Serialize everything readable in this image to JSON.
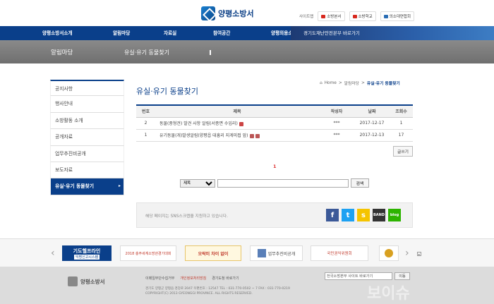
{
  "header": {
    "logo_text": "양평소방서",
    "sites_label": "사이트맵",
    "sites": [
      "소방본서",
      "소방학교",
      "의소대연합회"
    ]
  },
  "nav": {
    "items": [
      "양평소방서소개",
      "알림마당",
      "자료실",
      "참여공간",
      "양평의용소방대"
    ],
    "gg_link": "경기도재난안전본부 바로가기"
  },
  "band": {
    "section": "알림마당",
    "page": "유실·유기 동물찾기"
  },
  "sidebar": {
    "items": [
      {
        "label": "공지사항"
      },
      {
        "label": "행사안내"
      },
      {
        "label": "소방활동 소개"
      },
      {
        "label": "공개자료"
      },
      {
        "label": "업무추진비공개"
      },
      {
        "label": "보도자료"
      },
      {
        "label": "유실·유기 동물찾기",
        "arrow": "▸"
      }
    ]
  },
  "content": {
    "title": "유실·유기 동물찾기",
    "breadcrumb": {
      "home": "Home",
      "sep1": ">",
      "parent": "알림마당",
      "sep2": ">",
      "current": "유실·유기 동물찾기"
    },
    "table": {
      "headers": [
        "번호",
        "제목",
        "작성자",
        "날짜",
        "조회수"
      ],
      "rows": [
        {
          "no": "2",
          "title": "동물(중형견) 발견 사항 알림(서종면 수입리)",
          "author": "***",
          "date": "2017-12-17",
          "views": "1"
        },
        {
          "no": "1",
          "title": "유기동물(개)발생알림(양평읍 대흥리 지게미접 앞)",
          "author": "***",
          "date": "2017-12-13",
          "views": "17"
        }
      ]
    },
    "write_label": "글쓰기",
    "page_number": "1",
    "search": {
      "option": "제목",
      "button": "검색"
    },
    "sns_message": "해당 페이지는 SNS스크랩을 지원하고 있습니다.",
    "sns_icons": [
      "facebook-icon",
      "twitter-icon",
      "kakaostory-icon",
      "band-icon",
      "blog-icon"
    ]
  },
  "banners": {
    "b1": "기도헬프라인",
    "b1_sub": "익명신고시스템",
    "b2": "2018 충주세계소방관경기대회",
    "b3": "오락미 차이 없이",
    "b4": "업무추진비공개",
    "b5": "국민권익위원회"
  },
  "footer": {
    "logo_text": "양평소방서",
    "links": [
      "이메일무단수집거부",
      "개인정보처리방침",
      "경기도청 바로가기"
    ],
    "address1": "경기도 양평군 양평읍 경강로 2047 우편번호 : 12547  TEL : 031-770-0502 ~ 7  FAX : 031-770-0219",
    "address2": "COPYRIGHT(C) 2013 GYEONGGI PROVINCE. ALL RIGHTS RESERVED.",
    "select_label": "전국소방본부 사이트 바로가기",
    "go_button": "이동",
    "watermark": "보이슈"
  },
  "colors": {
    "primary": "#0a3f8a",
    "band": "#7a7a7a",
    "footer": "#dcdcdc"
  }
}
